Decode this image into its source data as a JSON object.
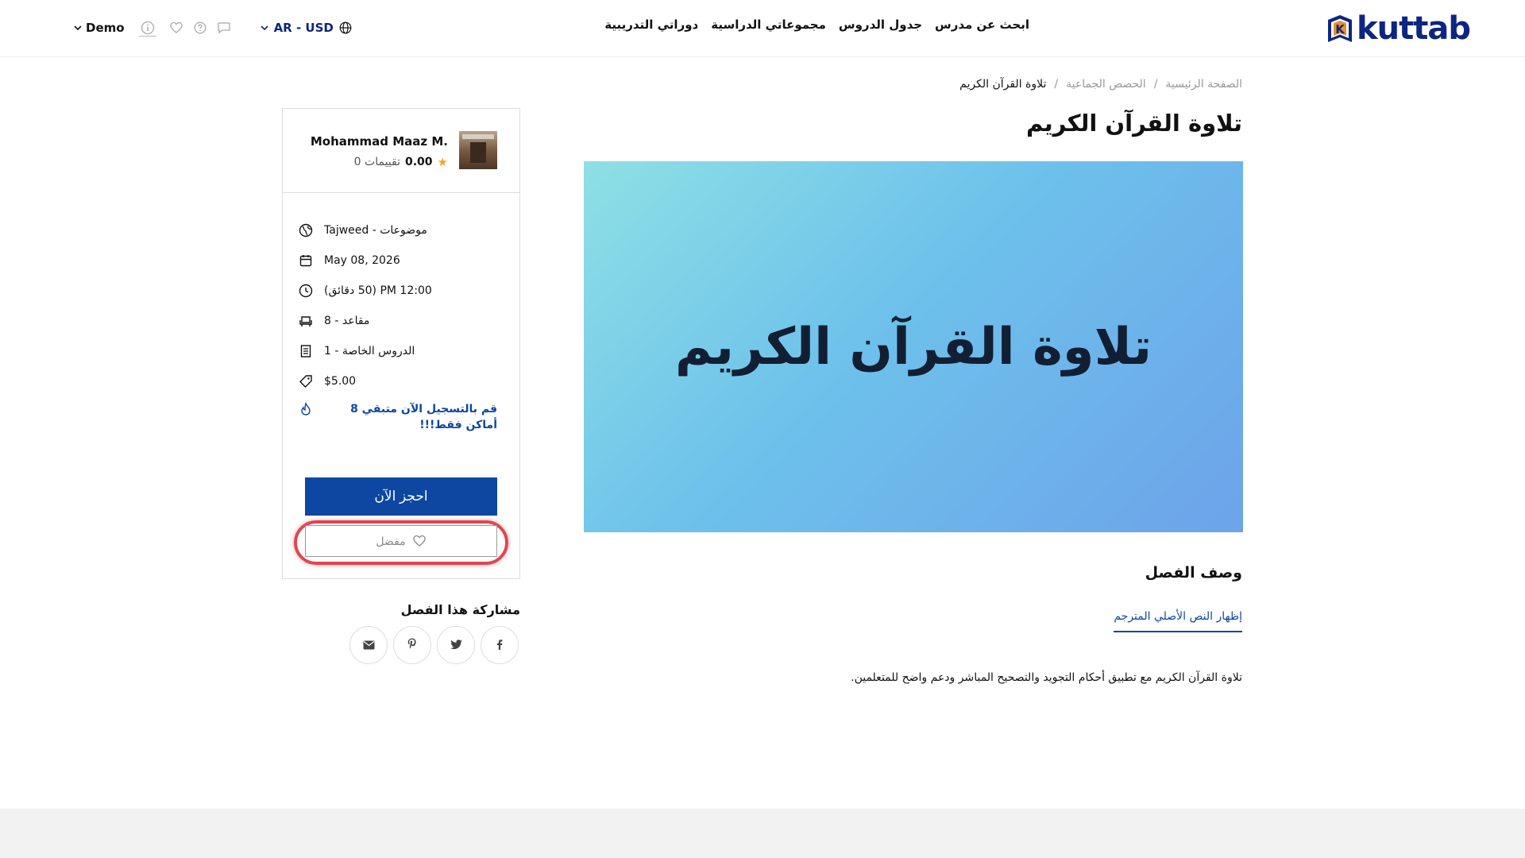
{
  "header": {
    "logo_text": "kuttab",
    "logo_letter": "K",
    "nav": [
      "ابحث عن مدرس",
      "جدول الدروس",
      "مجموعاتي الدراسية",
      "دوراتي التدريبية"
    ],
    "currency_label": "AR - USD",
    "user_label": "Demo",
    "colors": {
      "brand": "#0d2680",
      "accent": "#e8912d"
    }
  },
  "breadcrumb": [
    "الصفحة الرئيسية",
    "الحصص الجماعية",
    "تلاوة القرآن الكريم"
  ],
  "breadcrumb_separator": "/",
  "class": {
    "title": "تلاوة القرآن الكريم",
    "hero_text": "تلاوة القرآن الكريم",
    "description_title": "وصف الفصل",
    "translate_link": "إظهار النص الأصلي المترجم",
    "description": "تلاوة القرآن الكريم مع تطبيق أحكام التجويد والتصحيح المباشر ودعم واضح للمتعلمين."
  },
  "teacher": {
    "name": "Mohammad Maaz M.",
    "rating_value": "0.00",
    "rating_count": "0 تقييمات"
  },
  "details": {
    "topic": "موضوعات - Tajweed",
    "date": "May 08, 2026",
    "time": "12:00 PM (50 دقائق)",
    "seats": "مقاعد - 8",
    "lessons": "الدروس الخاصة - 1",
    "price": "$5.00",
    "urgency": "قم بالتسجيل الآن متبقي 8 أماكن فقط!!!"
  },
  "actions": {
    "book_label": "احجز الآن",
    "favorite_label": "مفضل"
  },
  "share": {
    "title": "مشاركة هذا الفصل",
    "networks": [
      "facebook-icon",
      "twitter-icon",
      "pinterest-icon",
      "email-icon"
    ]
  },
  "icons": {
    "header_tools": [
      "info-icon",
      "heart-icon",
      "help-icon",
      "chat-icon",
      "globe-icon",
      "chevron-down-icon"
    ]
  },
  "colors": {
    "primary": "#0d47a1",
    "highlight_ring": "#e0464f",
    "star": "#f5a623",
    "hero_gradient": [
      "#8ee0e4",
      "#6dc1eb",
      "#6da3ea"
    ]
  }
}
